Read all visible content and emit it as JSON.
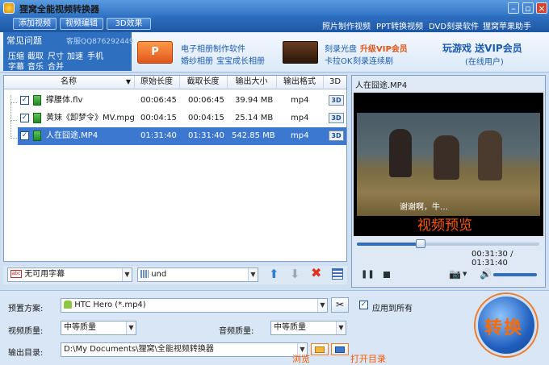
{
  "app": {
    "title": "狸窝全能视频转换器"
  },
  "toolbar": {
    "add_video": "添加视频",
    "edit_video": "视频编辑",
    "effect_3d": "3D效果",
    "links": [
      "照片制作视频",
      "PPT转换视频",
      "DVD刻录软件",
      "狸窝苹果助手"
    ]
  },
  "promo": {
    "faq_title": "常见问题",
    "faq_qq": "客服QQ876292449",
    "faq_row1": [
      "压缩",
      "截取",
      "尺寸",
      "加速",
      "手机"
    ],
    "faq_row2": [
      "字幕",
      "音乐",
      "合并"
    ],
    "ppt_icon": "P",
    "mid_line1": "电子相册制作软件",
    "mid_line2": [
      "婚纱相册",
      "宝宝成长相册"
    ],
    "dvd_line1": "刻录光盘",
    "dvd_line1_highlight": "升级VIP会员",
    "dvd_line2": [
      "卡拉OK",
      "刻录连续剧"
    ],
    "vip_line1": "玩游戏  送VIP会员",
    "vip_line2": "(在线用户)"
  },
  "file_list": {
    "columns": [
      "名称",
      "原始长度",
      "截取长度",
      "输出大小",
      "输出格式",
      "3D"
    ],
    "rows": [
      {
        "name": "撑腰体.flv",
        "orig": "00:06:45",
        "cut": "00:06:45",
        "size": "39.94 MB",
        "format": "mp4",
        "selected": false
      },
      {
        "name": "黄妹《卸梦令》MV.mpg",
        "orig": "00:04:15",
        "cut": "00:04:15",
        "size": "25.14 MB",
        "format": "mp4",
        "selected": false
      },
      {
        "name": "人在囧途.MP4",
        "orig": "01:31:40",
        "cut": "01:31:40",
        "size": "542.85 MB",
        "format": "mp4",
        "selected": true
      }
    ],
    "icon_3d": "3D"
  },
  "subtitle_bar": {
    "subtitle": "无可用字幕",
    "audio": "und"
  },
  "preview": {
    "title": "人在囧途.MP4",
    "caption": "谢谢啊，牛…",
    "annotation": "视频预览",
    "timecode": "00:31:30 / 01:31:40",
    "progress": 0.34
  },
  "settings": {
    "preset_label": "预置方案:",
    "preset_value": "HTC Hero (*.mp4)",
    "apply_all": "应用到所有",
    "video_quality_label": "视频质量:",
    "video_quality_value": "中等质量",
    "audio_quality_label": "音频质量:",
    "audio_quality_value": "中等质量",
    "output_label": "输出目录:",
    "output_value": "D:\\My Documents\\狸窝\\全能视频转换器",
    "browse_ann": "浏览",
    "open_ann": "打开目录",
    "convert_label": "转换"
  }
}
